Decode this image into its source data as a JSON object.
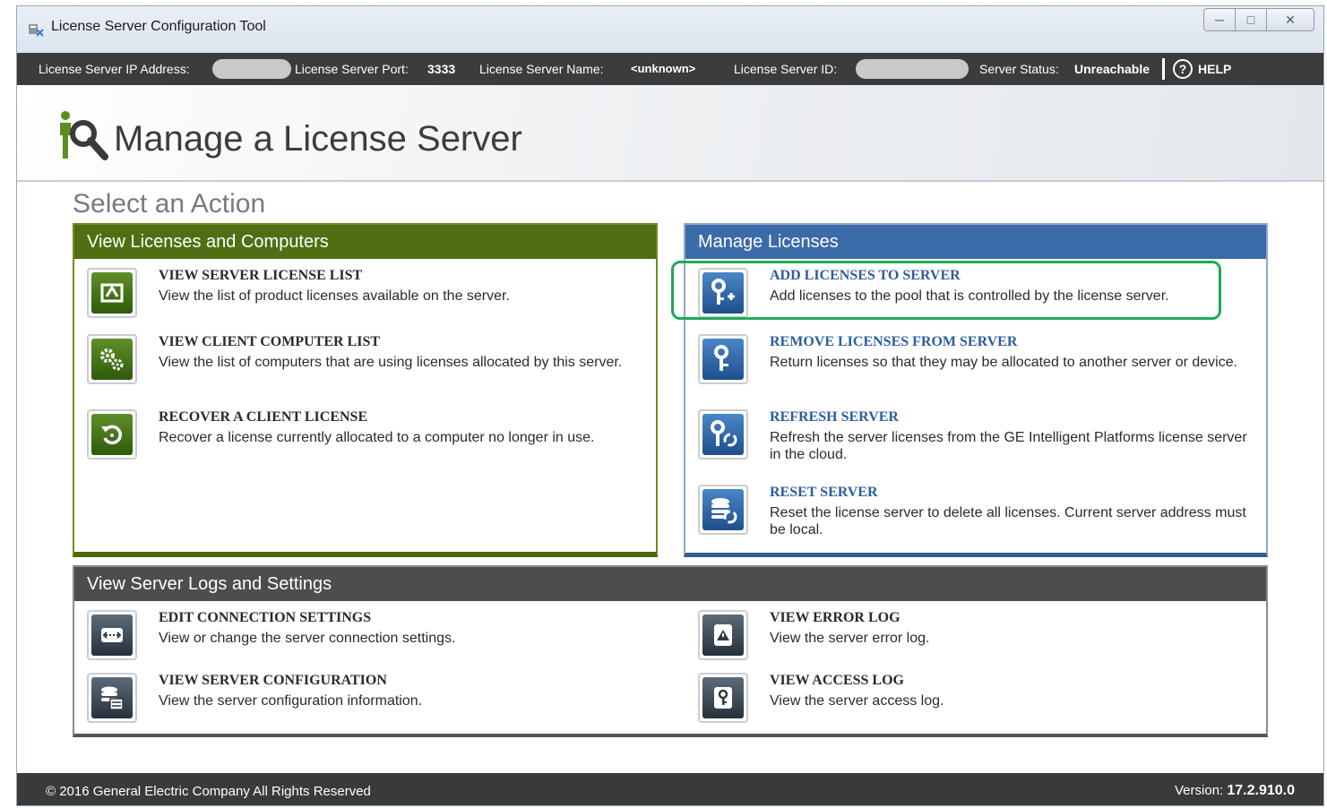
{
  "window": {
    "title": "License Server Configuration Tool"
  },
  "infobar": {
    "ip_label": "License Server IP Address:",
    "port_label": "License Server Port:",
    "port_value": "3333",
    "name_label": "License Server Name:",
    "name_value": "<unknown>",
    "id_label": "License Server ID:",
    "status_label": "Server Status:",
    "status_value": "Unreachable",
    "help_label": "HELP"
  },
  "header": {
    "title": "Manage a License Server"
  },
  "section_title": "Select an Action",
  "panels": {
    "view": {
      "title": "View Licenses and Computers",
      "items": [
        {
          "title": "VIEW SERVER LICENSE LIST",
          "desc": "View the list of product licenses available on the server."
        },
        {
          "title": "VIEW CLIENT COMPUTER LIST",
          "desc": "View the list of computers that are using licenses allocated by this server."
        },
        {
          "title": "RECOVER A CLIENT LICENSE",
          "desc": "Recover a license currently allocated to a computer no longer in use."
        }
      ]
    },
    "manage": {
      "title": "Manage Licenses",
      "items": [
        {
          "title": "ADD LICENSES TO SERVER",
          "desc": "Add licenses to the pool that is controlled by the license server."
        },
        {
          "title": "REMOVE LICENSES FROM SERVER",
          "desc": "Return licenses so that they may be allocated to another server or device."
        },
        {
          "title": "REFRESH SERVER",
          "desc": "Refresh the server licenses from the GE Intelligent Platforms license server in the cloud."
        },
        {
          "title": "RESET SERVER",
          "desc": "Reset the license server to delete all licenses. Current server address must be local."
        }
      ]
    },
    "logs": {
      "title": "View Server Logs and Settings",
      "items": [
        {
          "title": "EDIT CONNECTION SETTINGS",
          "desc": "View or change the server connection settings."
        },
        {
          "title": "VIEW SERVER CONFIGURATION",
          "desc": "View the server configuration information."
        },
        {
          "title": "VIEW ERROR LOG",
          "desc": "View the server error log."
        },
        {
          "title": "VIEW ACCESS LOG",
          "desc": "View the server access log."
        }
      ]
    }
  },
  "footer": {
    "copyright": "© 2016 General Electric Company  All Rights Reserved",
    "version_label": "Version:",
    "version_value": "17.2.910.0"
  },
  "icons": [
    "app-icon",
    "minimize-icon",
    "maximize-icon",
    "close-icon",
    "help-icon",
    "license-server-icon",
    "license-list-icon",
    "gears-icon",
    "recover-icon",
    "key-add-icon",
    "key-remove-icon",
    "key-refresh-icon",
    "database-reset-icon",
    "connection-icon",
    "server-config-icon",
    "error-log-icon",
    "access-log-icon"
  ],
  "colors": {
    "green": "#4f6f12",
    "blue": "#3b6aa8",
    "gray": "#4d4d4d",
    "highlight": "#1faa5a"
  }
}
